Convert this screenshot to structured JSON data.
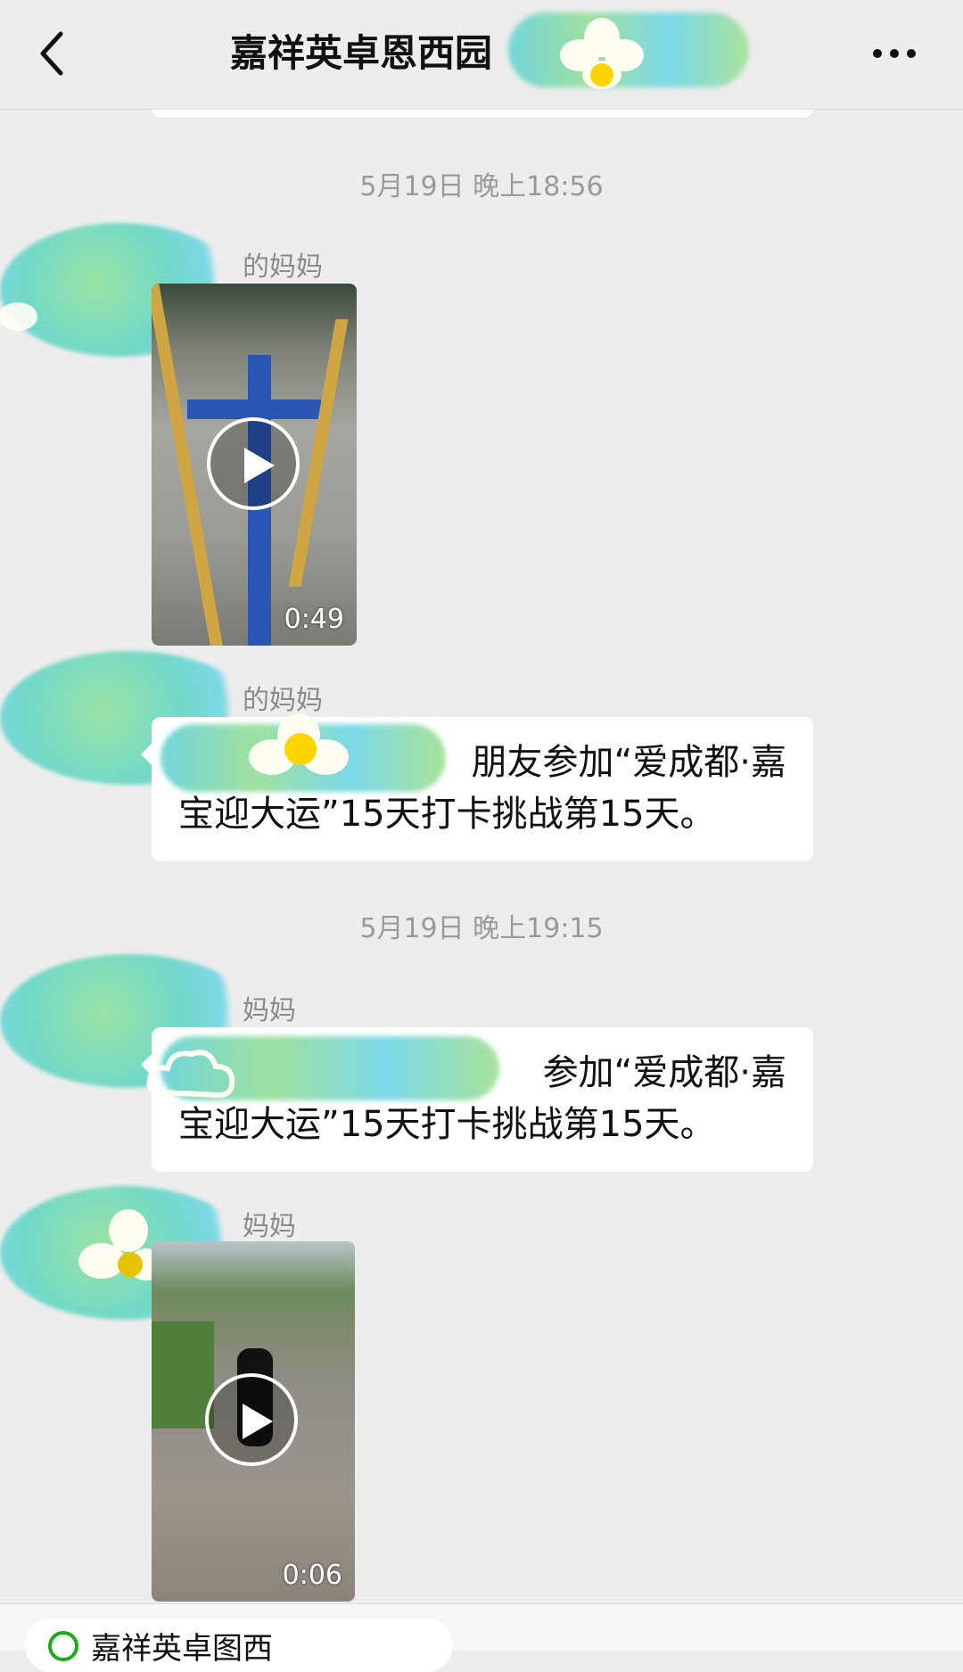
{
  "header": {
    "title": "嘉祥英卓恩西园",
    "back_icon": "chevron-left-icon",
    "more_icon": "more-dots-icon"
  },
  "messages": [
    {
      "timestamp": "5月19日 晚上18:56",
      "sender": "的妈妈",
      "type": "video",
      "duration": "0:49"
    },
    {
      "sender": "的妈妈",
      "type": "text",
      "text_line1": "朋友参加“爱成都·嘉",
      "text_line2": "宝迎大运”15天打卡挑战第15天。"
    },
    {
      "timestamp": "5月19日 晚上19:15",
      "sender": "妈妈",
      "type": "text",
      "text_line1": "参加“爱成都·嘉",
      "text_line2": "宝迎大运”15天打卡挑战第15天。"
    },
    {
      "sender": "妈妈",
      "type": "video",
      "duration": "0:06"
    }
  ],
  "footer": {
    "label": "嘉祥英卓图西"
  },
  "colors": {
    "background": "#ededed",
    "bubble": "#ffffff",
    "mask_teal": "#72d6d9",
    "mask_green": "#9fe0a0",
    "accent_green": "#1aad19"
  }
}
